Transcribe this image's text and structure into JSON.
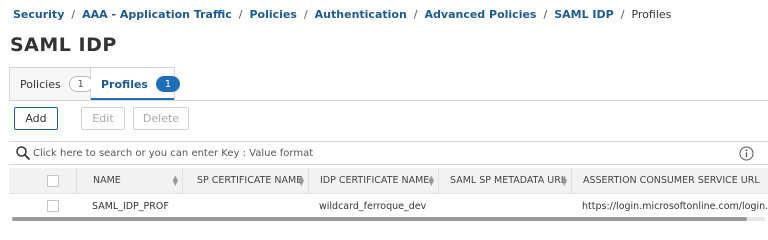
{
  "breadcrumb": {
    "items": [
      "Security",
      "AAA - Application Traffic",
      "Policies",
      "Authentication",
      "Advanced Policies",
      "SAML IDP"
    ],
    "current": "Profiles",
    "separator": "/"
  },
  "page": {
    "title": "SAML IDP"
  },
  "tabs": [
    {
      "label": "Policies",
      "count": "1",
      "active": false
    },
    {
      "label": "Profiles",
      "count": "1",
      "active": true
    }
  ],
  "toolbar": {
    "add_label": "Add",
    "edit_label": "Edit",
    "delete_label": "Delete"
  },
  "search": {
    "placeholder": "Click here to search or you can enter Key : Value format",
    "icon": "search-icon",
    "info_icon": "info-icon"
  },
  "table": {
    "columns": [
      "NAME",
      "SP CERTIFICATE NAME",
      "IDP CERTIFICATE NAME",
      "SAML SP METADATA URL",
      "ASSERTION CONSUMER SERVICE URL"
    ],
    "rows": [
      {
        "name": "SAML_IDP_PROF",
        "sp_cert": "",
        "idp_cert": "wildcard_ferroque_dev",
        "metadata_url": "",
        "acs_url": "https://login.microsoftonline.com/login.srf"
      }
    ]
  },
  "colors": {
    "accent": "#1e6fb6",
    "link": "#1e5a8c",
    "header_bg": "#f2f2f2"
  }
}
